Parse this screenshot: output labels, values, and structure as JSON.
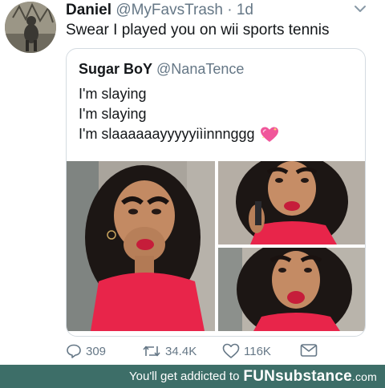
{
  "tweet": {
    "author_name": "Daniel",
    "author_handle": "@MyFavsTrash",
    "separator_time": " · 1d",
    "text": "Swear I played you on wii sports tennis"
  },
  "quoted_tweet": {
    "author_name": "Sugar BoY",
    "author_handle": "@NanaTence",
    "lines": [
      "I'm slaying",
      "I'm slaying",
      "I'm slaaaaaayyyyyiìinnnggg"
    ],
    "emoji": "sparkling-heart-icon"
  },
  "actions": {
    "reply_count": "309",
    "retweet_count": "34.4K",
    "like_count": "116K"
  },
  "footer": {
    "tagline": "You'll get addicted to",
    "brand_prefix": "FUN",
    "brand_main": "substance",
    "brand_domain": ".com"
  },
  "colors": {
    "footer_bg": "#3d6e68",
    "secondary_text": "#657786",
    "dress": "#e8254a"
  }
}
